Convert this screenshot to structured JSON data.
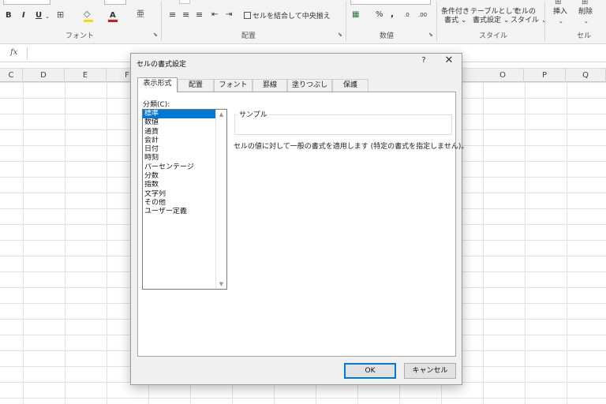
{
  "ribbon": {
    "font_group_label": "フォント",
    "alignment_group_label": "配置",
    "number_group_label": "数値",
    "styles_group_label": "スタイル",
    "cells_group_label": "セル",
    "merge_center_label": "セルを結合して中央揃え",
    "number_percent": "%",
    "number_comma": ",",
    "conditional_format_label_1": "条件付き",
    "conditional_format_label_2": "書式",
    "format_table_label_1": "テーブルとして",
    "format_table_label_2": "書式設定",
    "cell_styles_label_1": "セルの",
    "cell_styles_label_2": "スタイル",
    "insert_label": "挿入",
    "delete_label": "削除",
    "bold_label": "B",
    "italic_label": "I",
    "underline_label": "U",
    "font_color_glyph": "A"
  },
  "formula_bar": {
    "fx_label": "fx"
  },
  "columns": [
    "C",
    "D",
    "E",
    "F",
    "O",
    "P",
    "Q"
  ],
  "dialog": {
    "title": "セルの書式設定",
    "help": "?",
    "close": "✕",
    "tabs": [
      "表示形式",
      "配置",
      "フォント",
      "罫線",
      "塗りつぶし",
      "保護"
    ],
    "active_tab": "表示形式",
    "category_label": "分類(C):",
    "categories": [
      "標準",
      "数値",
      "通貨",
      "会計",
      "日付",
      "時刻",
      "パーセンテージ",
      "分数",
      "指数",
      "文字列",
      "その他",
      "ユーザー定義"
    ],
    "selected_category": "標準",
    "sample_label": "サンプル",
    "description": "セルの値に対して一般の書式を適用します (特定の書式を指定しません)。",
    "ok_label": "OK",
    "cancel_label": "キャンセル"
  },
  "colors": {
    "selection": "#0078d7",
    "dialog_bg": "#f0f0f0",
    "ribbon_bg": "#f3f3f3",
    "font_color_red": "#d7191c",
    "fill_color_yellow": "#ffd700"
  }
}
